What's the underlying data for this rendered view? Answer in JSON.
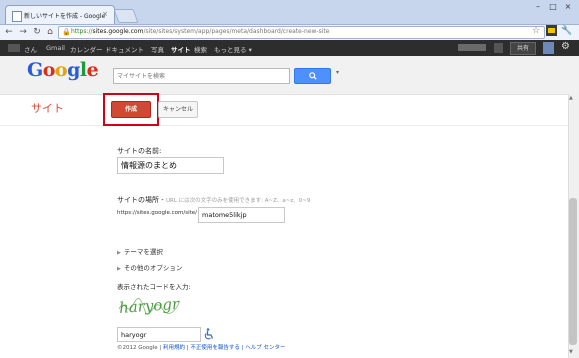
{
  "browser": {
    "tab_title": "新しいサイトを作成 - Google",
    "tab_close": "×",
    "url_scheme": "https://",
    "url_host": "sites.google.com",
    "url_path": "/site/sites/system/app/pages/meta/dashboard/create-new-site"
  },
  "gbar": {
    "items": [
      "さん",
      "Gmail",
      "カレンダー",
      "ドキュメント",
      "写真",
      "サイト",
      "検索",
      "もっと見る ▾"
    ],
    "share_label": "共有"
  },
  "header": {
    "logo_letters": [
      "G",
      "o",
      "o",
      "g",
      "l",
      "e"
    ],
    "logo_colors": [
      "#2a5bd7",
      "#d6301a",
      "#e8a400",
      "#2a5bd7",
      "#1e9b3b",
      "#d6301a"
    ],
    "search_placeholder": "マイサイトを検索",
    "dropdown_arrow": "▾"
  },
  "titlebar": {
    "title": "サイト",
    "create_label": "作成",
    "cancel_label": "キャンセル"
  },
  "form": {
    "name_label": "サイトの名前:",
    "name_value": "情報源のまとめ",
    "location_label": "サイトの場所 -",
    "location_hint": "URL には次の文字のみを使用できます: A~Z、a~z、0~9",
    "url_prefix": "https://sites.google.com/site/",
    "url_value": "matome5likjp",
    "theme_label": "テーマを選択",
    "more_options_label": "その他のオプション",
    "captcha_label": "表示されたコードを入力:",
    "captcha_text": "haryogr",
    "captcha_value": "haryogr"
  },
  "footer": {
    "copyright": "©2012 Google |",
    "terms": "利用規約",
    "report": "| 不正使用を報告する",
    "help": "| ヘルプ センター"
  }
}
